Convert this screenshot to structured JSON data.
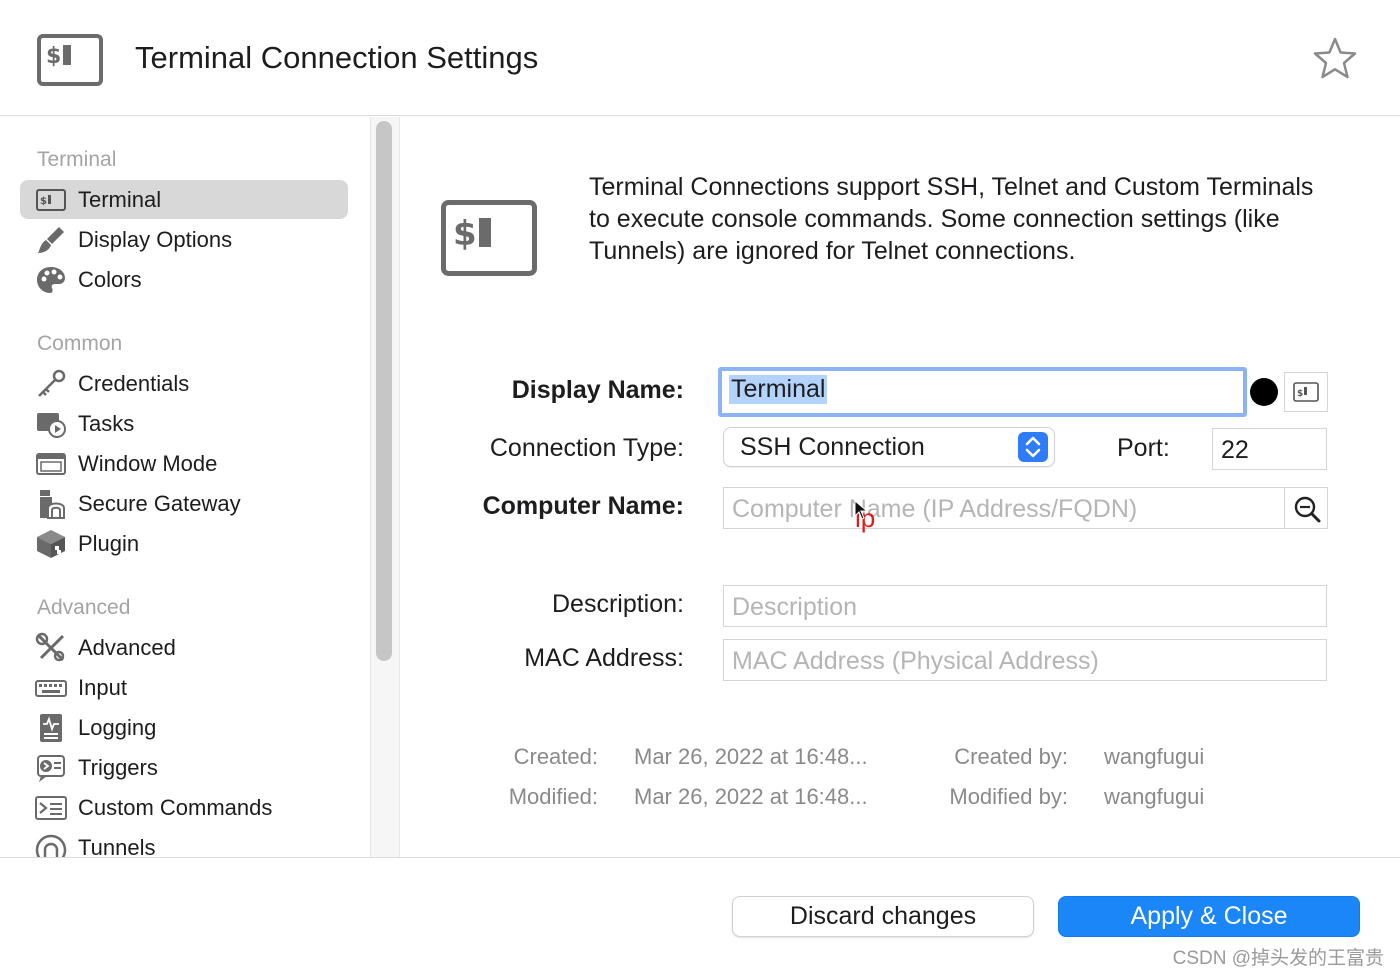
{
  "header": {
    "title": "Terminal Connection Settings",
    "icon": "terminal-icon",
    "favorite_icon": "star-icon"
  },
  "sidebar": {
    "sections": [
      {
        "label": "Terminal",
        "items": [
          {
            "label": "Terminal",
            "icon": "terminal-icon",
            "selected": true
          },
          {
            "label": "Display Options",
            "icon": "brush-icon"
          },
          {
            "label": "Colors",
            "icon": "palette-icon"
          }
        ]
      },
      {
        "label": "Common",
        "items": [
          {
            "label": "Credentials",
            "icon": "key-icon"
          },
          {
            "label": "Tasks",
            "icon": "tasks-icon"
          },
          {
            "label": "Window Mode",
            "icon": "window-icon"
          },
          {
            "label": "Secure Gateway",
            "icon": "gateway-icon"
          },
          {
            "label": "Plugin",
            "icon": "cube-icon"
          }
        ]
      },
      {
        "label": "Advanced",
        "items": [
          {
            "label": "Advanced",
            "icon": "tools-icon"
          },
          {
            "label": "Input",
            "icon": "keyboard-icon"
          },
          {
            "label": "Logging",
            "icon": "log-icon"
          },
          {
            "label": "Triggers",
            "icon": "trigger-icon"
          },
          {
            "label": "Custom Commands",
            "icon": "command-icon"
          },
          {
            "label": "Tunnels",
            "icon": "tunnel-icon"
          }
        ]
      }
    ]
  },
  "main": {
    "intro": "Terminal Connections support SSH, Telnet and Custom Terminals to execute console commands. Some connection settings (like Tunnels) are ignored for Telnet connections.",
    "form": {
      "display_name_label": "Display Name:",
      "display_name_value": "Terminal",
      "connection_type_label": "Connection Type:",
      "connection_type_value": "SSH Connection",
      "port_label": "Port:",
      "port_value": "22",
      "computer_name_label": "Computer Name:",
      "computer_name_placeholder": "Computer Name (IP Address/FQDN)",
      "description_label": "Description:",
      "description_placeholder": "Description",
      "mac_label": "MAC Address:",
      "mac_placeholder": "MAC Address (Physical Address)"
    },
    "meta": {
      "created_label": "Created:",
      "created_value": "Mar 26, 2022 at 16:48...",
      "modified_label": "Modified:",
      "modified_value": "Mar 26, 2022 at 16:48...",
      "created_by_label": "Created by:",
      "created_by_value": "wangfugui",
      "modified_by_label": "Modified by:",
      "modified_by_value": "wangfugui"
    },
    "annotation": "ip"
  },
  "footer": {
    "discard_label": "Discard changes",
    "apply_label": "Apply & Close",
    "watermark": "CSDN @掉头发的王富贵"
  },
  "colors": {
    "accent": "#1a86f7",
    "focus_ring": "#8cb4f3",
    "selection": "#d8d8d8",
    "annotation": "#e11b1b"
  }
}
